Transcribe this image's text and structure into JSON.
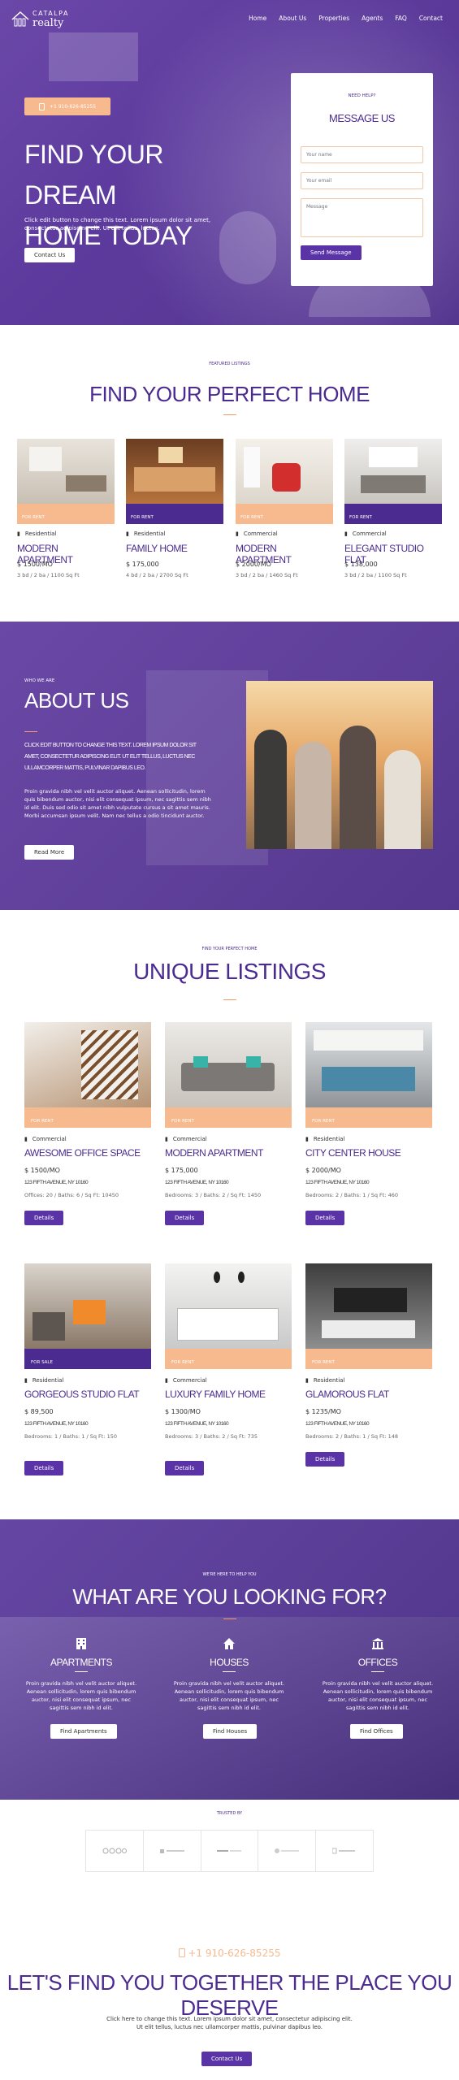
{
  "brand": {
    "line1": "CATALPA",
    "line2": "realty"
  },
  "nav": [
    "Home",
    "About Us",
    "Properties",
    "Agents",
    "FAQ",
    "Contact"
  ],
  "hero": {
    "phone": "+1 910-626-85255",
    "title_line1": "FIND YOUR DREAM",
    "title_line2": "HOME TODAY",
    "lead": "Click edit button to change this text. Lorem ipsum dolor sit amet, consectetur adipiscing elit. Ut elit tellus, luctus.",
    "button": "Contact Us"
  },
  "form": {
    "eyebrow": "NEED HELP?",
    "title": "MESSAGE US",
    "name_placeholder": "Your name",
    "email_placeholder": "Your email",
    "message_placeholder": "Message",
    "send": "Send Message"
  },
  "featured": {
    "eyebrow": "FEATURED LISTINGS",
    "title": "FIND YOUR PERFECT HOME",
    "cards": [
      {
        "band": "FOR RENT",
        "category": "Residential",
        "name": "MODERN APARTMENT",
        "price": "$ 1500/MO",
        "meta": "3 bd / 2 ba / 1100 Sq Ft"
      },
      {
        "band": "FOR RENT",
        "category": "Residential",
        "name": "FAMILY HOME",
        "price": "$ 175,000",
        "meta": "4 bd / 2 ba / 2700 Sq Ft"
      },
      {
        "band": "FOR RENT",
        "category": "Commercial",
        "name": "MODERN APARTMENT",
        "price": "$ 2000/MO",
        "meta": "3 bd / 2 ba / 1460 Sq Ft"
      },
      {
        "band": "FOR RENT",
        "category": "Commercial",
        "name": "ELEGANT STUDIO FLAT",
        "price": "$ 138,000",
        "meta": "3 bd / 2 ba / 1100 Sq Ft"
      }
    ]
  },
  "about": {
    "eyebrow": "WHO WE ARE",
    "title": "ABOUT US",
    "bold": "CLICK EDIT BUTTON TO CHANGE THIS TEXT. LOREM IPSUM DOLOR SIT AMET, CONSECTETUR ADIPISCING ELIT. UT ELIT TELLUS, LUCTUS NEC ULLAMCORPER MATTIS, PULVINAR DAPIBUS LEO.",
    "body": "Proin gravida nibh vel velit auctor aliquet. Aenean sollicitudin, lorem quis bibendum auctor, nisi elit consequat ipsum, nec sagittis sem nibh id elit. Duis sed odio sit amet nibh vulputate cursus a sit amet mauris. Morbi accumsan ipsum velit. Nam nec tellus a odio tincidunt auctor.",
    "button": "Read More"
  },
  "unique": {
    "eyebrow": "FIND YOUR PERFECT HOME",
    "title": "UNIQUE LISTINGS",
    "cards": [
      {
        "band": "FOR RENT",
        "category": "Commercial",
        "name": "AWESOME OFFICE SPACE",
        "price": "$ 1500/MO",
        "address": "123 FIFTH AVENUE, NY 10160",
        "meta": "Offices: 20 / Baths: 6 / Sq Ft: 10450",
        "button": "Details"
      },
      {
        "band": "FOR RENT",
        "category": "Commercial",
        "name": "MODERN APARTMENT",
        "price": "$ 175,000",
        "address": "123 FIFTH AVENUE, NY 10160",
        "meta": "Bedrooms: 3 / Baths: 2 / Sq Ft: 1450",
        "button": "Details"
      },
      {
        "band": "FOR RENT",
        "category": "Residential",
        "name": "CITY CENTER HOUSE",
        "price": "$ 2000/MO",
        "address": "123 FIFTH AVENUE, NY 10160",
        "meta": "Bedrooms: 2 / Baths: 1 / Sq Ft: 460",
        "button": "Details"
      },
      {
        "band": "FOR SALE",
        "category": "Residential",
        "name": "GORGEOUS STUDIO FLAT",
        "price": "$ 89,500",
        "address": "123 FIFTH AVENUE, NY 10160",
        "meta": "Bedrooms: 1 / Baths: 1 / Sq Ft: 150",
        "button": "Details"
      },
      {
        "band": "FOR RENT",
        "category": "Commercial",
        "name": "LUXURY FAMILY HOME",
        "price": "$ 1300/MO",
        "address": "123 FIFTH AVENUE, NY 10160",
        "meta": "Bedrooms: 3 / Baths: 2 / Sq Ft: 735",
        "button": "Details"
      },
      {
        "band": "FOR RENT",
        "category": "Residential",
        "name": "GLAMOROUS FLAT",
        "price": "$ 1235/MO",
        "address": "123 FIFTH AVENUE, NY 10160",
        "meta": "Bedrooms: 2 / Baths: 1 / Sq Ft: 148",
        "button": "Details"
      }
    ]
  },
  "looking": {
    "eyebrow": "WE'RE HERE TO HELP YOU",
    "title": "WHAT ARE YOU LOOKING FOR?",
    "cols": [
      {
        "title": "APARTMENTS",
        "desc": "Proin gravida nibh vel velit auctor aliquet. Aenean sollicitudin, lorem quis bibendum auctor, nisi elit consequat ipsum, nec sagittis sem nibh id elit.",
        "button": "Find Apartments",
        "icon": "building-icon"
      },
      {
        "title": "HOUSES",
        "desc": "Proin gravida nibh vel velit auctor aliquet. Aenean sollicitudin, lorem quis bibendum auctor, nisi elit consequat ipsum, nec sagittis sem nibh id elit.",
        "button": "Find Houses",
        "icon": "house-icon"
      },
      {
        "title": "OFFICES",
        "desc": "Proin gravida nibh vel velit auctor aliquet. Aenean sollicitudin, lorem quis bibendum auctor, nisi elit consequat ipsum, nec sagittis sem nibh id elit.",
        "button": "Find Offices",
        "icon": "bank-icon"
      }
    ]
  },
  "trusted": {
    "eyebrow": "TRUSTED BY",
    "logos": [
      "logo-1",
      "logo-2",
      "logo-3",
      "logo-4",
      "logo-5"
    ]
  },
  "cta": {
    "phone": "+1 910-626-85255",
    "title": "LET'S FIND YOU TOGETHER THE PLACE YOU DESERVE",
    "desc": "Click here to change this text. Lorem ipsum dolor sit amet, consectetur adipiscing elit. Ut elit tellus, luctus nec ullamcorper mattis, pulvinar dapibus leo.",
    "button": "Contact Us"
  }
}
